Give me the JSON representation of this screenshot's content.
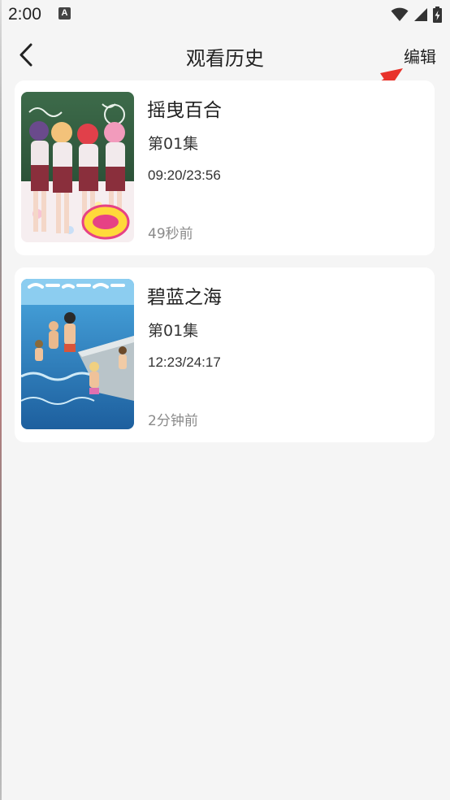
{
  "status_bar": {
    "time": "2:00",
    "notification_icon": "A",
    "icons": [
      "wifi-icon",
      "signal-icon",
      "battery-charging-icon"
    ]
  },
  "header": {
    "title": "观看历史",
    "back_icon": "chevron-left-icon",
    "edit_label": "编辑"
  },
  "history": [
    {
      "title": "摇曳百合",
      "episode": "第01集",
      "progress": "09:20/23:56",
      "time_ago": "49秒前"
    },
    {
      "title": "碧蓝之海",
      "episode": "第01集",
      "progress": "12:23/24:17",
      "time_ago": "2分钟前"
    }
  ],
  "colors": {
    "background": "#f5f5f5",
    "card": "#ffffff",
    "annotation": "#e8322a",
    "muted_text": "#8a8a8a"
  }
}
